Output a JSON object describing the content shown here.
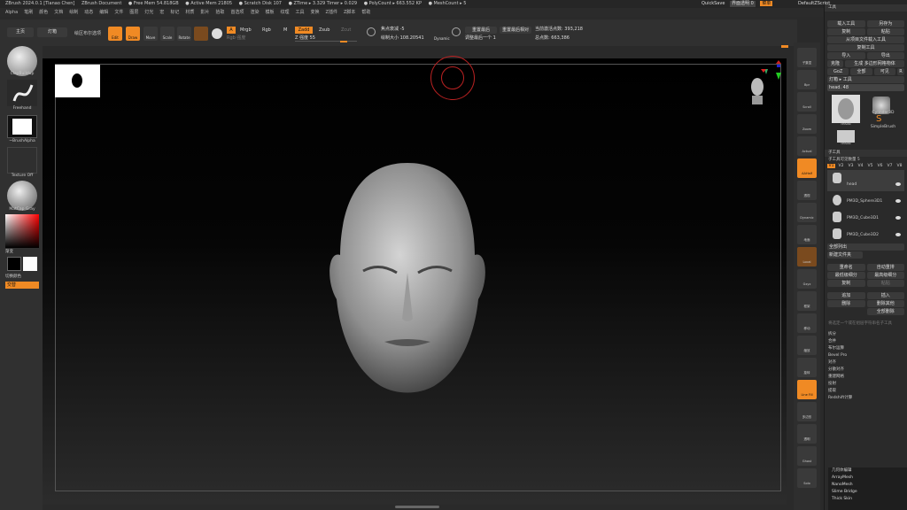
{
  "titlebar": {
    "app": "ZBrush 2024.0.1 [Tianao Chen]",
    "doc": "ZBrush Document",
    "free_mem": "● Free Mem 54.818GB",
    "active_mem": "● Active Mem 21805",
    "scratch": "● Scratch Disk 107",
    "ztime": "● ZTime ▸ 3.329 Timer ▸ 0.029",
    "poly": "● PolyCount ▸ 663.552 KP",
    "mesh": "● MeshCount ▸ 5",
    "quicksave": "QuickSave",
    "transparency": "界面透明 0",
    "menu_btn": "菜单",
    "script": "DefaultZScript"
  },
  "menu": [
    "Alpha",
    "笔刷",
    "颜色",
    "文档",
    "绘制",
    "动态",
    "编辑",
    "文件",
    "图层",
    "灯光",
    "宏",
    "标记",
    "材质",
    "影片",
    "拾取",
    "首选项",
    "渲染",
    "模板",
    "纹理",
    "工具",
    "变换",
    "Z插件",
    "Z脚本",
    "帮助"
  ],
  "topshelf": {
    "home": "主页",
    "light": "灯箱",
    "projects": "绘区布尔选项",
    "edit": "Edit",
    "draw": "Draw",
    "move": "Move",
    "scale": "Scale",
    "rotate": "Rotate",
    "a": "A",
    "mrgb": "Mrgb",
    "rgb": "Rgb",
    "m": "M",
    "zadd": "Zadd",
    "zsub": "Zsub",
    "zcut": "Zcut",
    "rgb_intensity": "Rgb 强度",
    "z_intensity": "Z 强度 55",
    "focal": "焦点衰减 -5",
    "draw_size": "绘制大小 108.20541",
    "dynamic": "Dynamic",
    "sym_label": "重置最后",
    "sym2": "重置最后相对",
    "adjust": "调整最后一个 1",
    "active_points": "当前激活点数: 393,218",
    "total_points": "总点数: 663,386"
  },
  "left": {
    "brush": "ClayBuildup",
    "stroke": "Freehand",
    "alpha": "~BrushAlpha",
    "texture": "Texture Off",
    "material": "MatCap Gray",
    "gradient": "渐变",
    "switch": "切换颜色",
    "alt": "交替"
  },
  "right_shelf": [
    "子集显",
    "Bpr",
    "Scroll",
    "Zoom",
    "Actual",
    "AAHalf",
    "透视",
    "Dynamic",
    "地面",
    "Local",
    "Gxyz",
    "框架",
    "移动",
    "缩放",
    "旋转",
    "Line Fill",
    "多边形",
    "透明",
    "Ghost",
    "Solo"
  ],
  "tool": {
    "header": "工具",
    "load": "载入工具",
    "save_as": "另存为",
    "copy": "复制",
    "paste": "粘贴",
    "import_from_file": "从项目文件载入工具",
    "clone": "复制工具",
    "import": "导入",
    "export": "导出",
    "clone2": "克隆",
    "make_poly": "生成 多边形网格物体",
    "goz": "GoZ",
    "all": "全部",
    "visible": "可见",
    "r": "R",
    "lightbox_tools": "灯箱 ▸ 工具",
    "head_label": "head. 48",
    "thumb1": "head",
    "thumb2": "Cylinder3D",
    "thumb3": "SimpleBrush",
    "thumb4": "head",
    "subtool_header": "子工具",
    "subtool_count": "子工具可见数量 5",
    "versions": [
      "V1",
      "V2",
      "V3",
      "V4",
      "V5",
      "V6",
      "V7",
      "V8"
    ],
    "subtools": [
      "head",
      "PM3D_Sphere3D1",
      "PM3D_Cube3D1",
      "PM3D_Cube3D2"
    ],
    "list_all": "全部列出",
    "new_folder": "新建文件夹",
    "rename": "重命名",
    "auto_reorder": "自动重排",
    "all_low": "最低级细分",
    "all_high": "最高级细分",
    "copy2": "复制",
    "paste2": "粘贴",
    "append": "追加",
    "insert": "插入",
    "delete": "删除",
    "del_other": "删除其他",
    "del_all": "全部删除",
    "hint": "将选定一个或在组层字符串名子工具",
    "list_items": [
      "拆分",
      "合并",
      "布尔运算",
      "Bevel Pro",
      "对齐",
      "分散对齐",
      "重建网格",
      "投射",
      "提取"
    ],
    "redesign": "Redshift计算",
    "geo_header": "几何体编辑",
    "geo_items": [
      "ArrayMesh",
      "NanoMesh",
      "Slime Bridge",
      "Thick Skin"
    ]
  }
}
